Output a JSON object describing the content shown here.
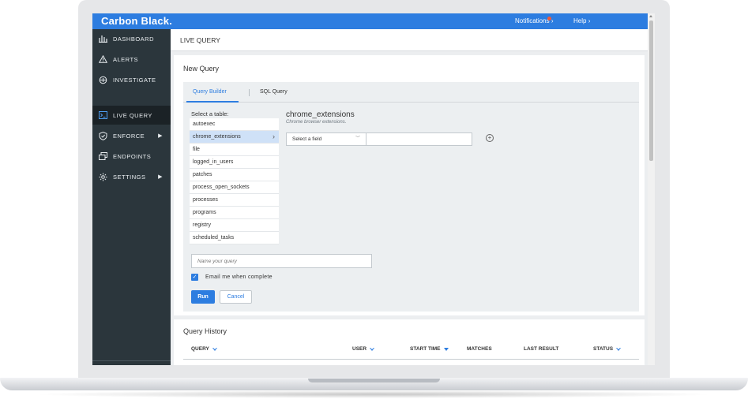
{
  "app": {
    "brand": "Carbon Black."
  },
  "topnav": {
    "notifications": "Notifications",
    "help": "Help"
  },
  "sidebar": {
    "items": [
      {
        "label": "DASHBOARD",
        "icon": "bar-chart-icon"
      },
      {
        "label": "ALERTS",
        "icon": "warning-icon"
      },
      {
        "label": "INVESTIGATE",
        "icon": "crosshair-icon"
      },
      {
        "label": "LIVE QUERY",
        "icon": "terminal-icon"
      },
      {
        "label": "ENFORCE",
        "icon": "shield-check-icon"
      },
      {
        "label": "ENDPOINTS",
        "icon": "windows-icon"
      },
      {
        "label": "SETTINGS",
        "icon": "gear-icon"
      }
    ]
  },
  "page": {
    "title": "LIVE QUERY"
  },
  "new_query": {
    "title": "New Query",
    "tabs": [
      {
        "label": "Query Builder"
      },
      {
        "label": "SQL Query"
      }
    ],
    "select_table_label": "Select a table:",
    "tables": [
      "autoexec",
      "chrome_extensions",
      "file",
      "logged_in_users",
      "patches",
      "process_open_sockets",
      "processes",
      "programs",
      "registry",
      "scheduled_tasks"
    ],
    "selected_table": "chrome_extensions",
    "selected_description": "Chrome browser extensions.",
    "field_select_value": "Select a field",
    "field_value": "",
    "name_placeholder": "Name your query",
    "email_label": "Email me when complete",
    "email_checked": true,
    "run_label": "Run",
    "cancel_label": "Cancel"
  },
  "query_history": {
    "title": "Query History",
    "columns": [
      {
        "label": "QUERY",
        "sort": "outline"
      },
      {
        "label": "USER",
        "sort": "outline"
      },
      {
        "label": "START TIME",
        "sort": "solid"
      },
      {
        "label": "MATCHES",
        "sort": ""
      },
      {
        "label": "LAST RESULT",
        "sort": ""
      },
      {
        "label": "STATUS",
        "sort": "outline"
      }
    ]
  },
  "colors": {
    "accent": "#2d7de0",
    "sidebar": "#2b363c",
    "sidebar_active": "#1b2226",
    "notification_dot": "#f15a3a"
  }
}
